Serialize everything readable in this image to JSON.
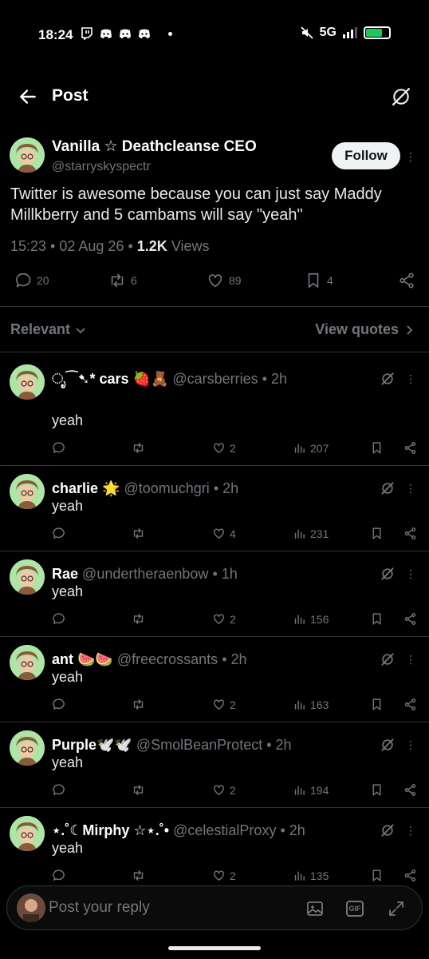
{
  "status_bar": {
    "time": "18:24",
    "network": "5G",
    "battery_percent": 70
  },
  "header": {
    "title": "Post"
  },
  "post": {
    "author_name": "Vanilla ☆ Deathcleanse CEO",
    "author_handle": "@starryskyspectr",
    "follow_label": "Follow",
    "text": "Twitter is awesome because you can just say Maddy Millkberry and 5 cambams will say \"yeah\"",
    "time": "15:23",
    "date": "02 Aug 26",
    "views_count": "1.2K",
    "views_label": "Views",
    "stats": {
      "replies": "20",
      "reposts": "6",
      "likes": "89",
      "bookmarks": "4"
    }
  },
  "filter": {
    "sort_label": "Relevant",
    "quotes_label": "View quotes"
  },
  "replies": [
    {
      "name": "ೃ⁀➷* cars 🍓🧸",
      "handle": "@carsberries",
      "time": "2h",
      "text": "yeah",
      "likes": "2",
      "views": "207"
    },
    {
      "name": "charlie 🌟",
      "handle": "@toomuchgri",
      "time": "2h",
      "text": "yeah",
      "likes": "4",
      "views": "231"
    },
    {
      "name": "Rae",
      "handle": "@undertheraenbow",
      "time": "1h",
      "text": "yeah",
      "likes": "2",
      "views": "156"
    },
    {
      "name": "ant 🍉🍉",
      "handle": "@freecrossants",
      "time": "2h",
      "text": "yeah",
      "likes": "2",
      "views": "163"
    },
    {
      "name": "Purple🕊️🕊️",
      "handle": "@SmolBeanProtect",
      "time": "2h",
      "text": "yeah",
      "likes": "2",
      "views": "194"
    },
    {
      "name": "⋆.˚☾Mirphy ☆⋆.˚•",
      "handle": "@celestialProxy",
      "time": "2h",
      "text": "yeah",
      "likes": "2",
      "views": "135"
    }
  ],
  "composer": {
    "placeholder": "Post your reply",
    "gif_label": "GIF"
  },
  "colors": {
    "background": "#000000",
    "muted": "#71767b",
    "text": "#e7e9ea",
    "battery": "#22c55e"
  }
}
